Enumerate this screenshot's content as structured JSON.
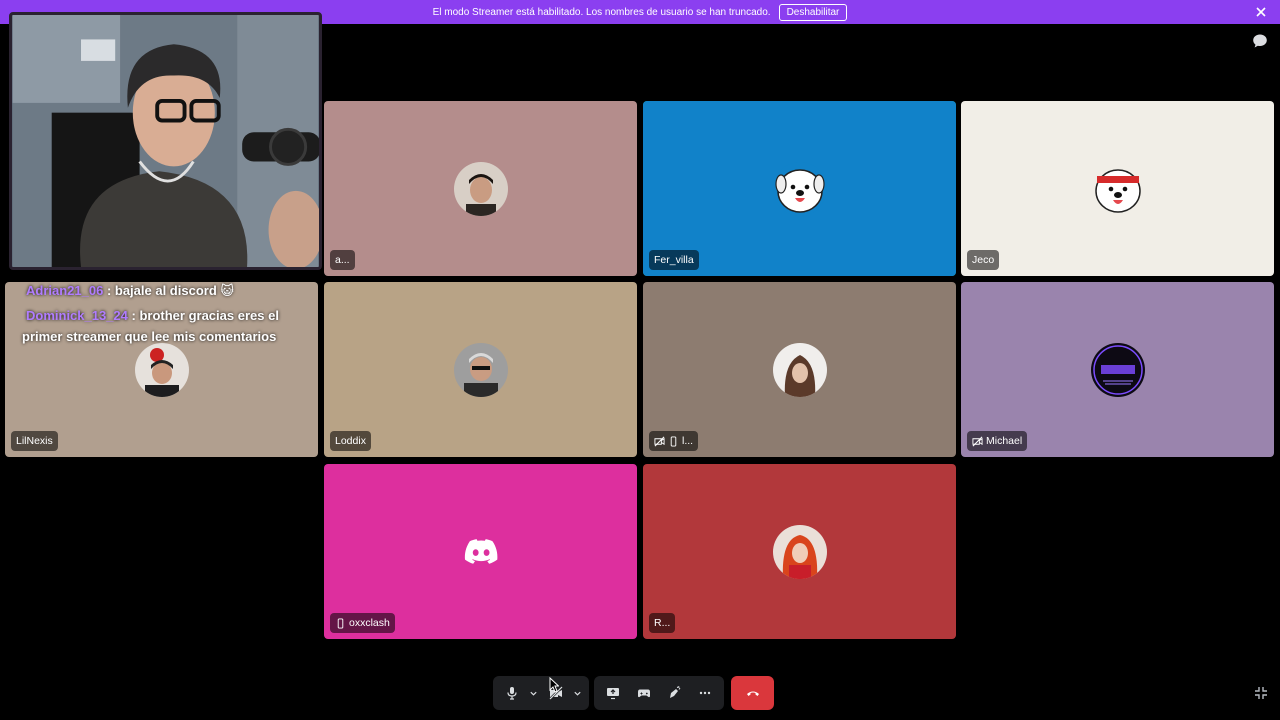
{
  "banner": {
    "message": "El modo Streamer está habilitado. Los nombres de usuario se han truncado.",
    "disable_label": "Deshabilitar",
    "color": "#8b3ff0"
  },
  "tiles": [
    {
      "name": "a...",
      "bg": "#b48d8c"
    },
    {
      "name": "Fer_villa",
      "bg": "#1182c9"
    },
    {
      "name": "Jeco",
      "bg": "#f1eee7"
    },
    {
      "name": "LilNexis",
      "bg": "#b19f8f"
    },
    {
      "name": "Loddix",
      "bg": "#b8a386"
    },
    {
      "name": "l...",
      "bg": "#8d7c70"
    },
    {
      "name": "Michael",
      "bg": "#9a84ad"
    },
    {
      "name": "oxxclash",
      "bg": "#dd2f9e"
    },
    {
      "name": "R...",
      "bg": "#b2383b"
    }
  ],
  "chat": [
    {
      "user": "Adrian21_06",
      "text": "bajale al discord 😺"
    },
    {
      "user": "Dominick_13_24",
      "text": "brother gracias eres el primer streamer que lee mis comentarios"
    }
  ],
  "chat_separator": " : ",
  "controls": {
    "mic": "microphone-icon",
    "camera": "camera-off-icon",
    "screen": "screen-share-icon",
    "activity": "gamepad-icon",
    "soundboard": "soundboard-icon",
    "more": "more-icon",
    "hangup": "hangup-icon",
    "hangup_color": "#da373c"
  }
}
